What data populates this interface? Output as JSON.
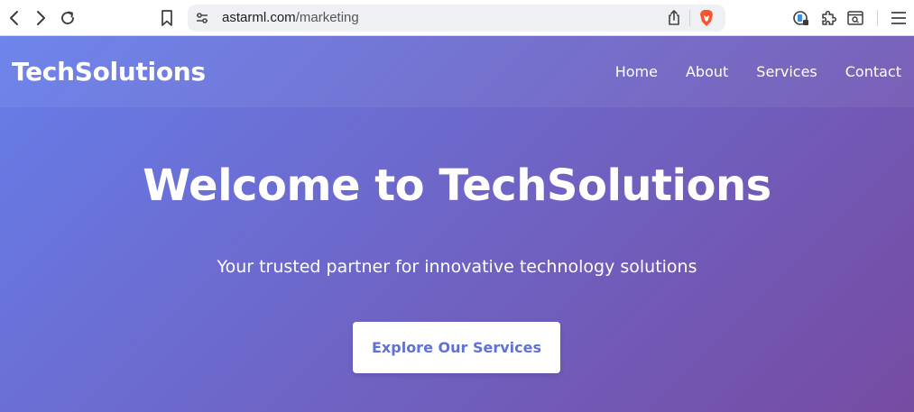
{
  "browser": {
    "url_host": "astarml.com",
    "url_path": "/marketing",
    "brave_color": "#fb542b"
  },
  "site": {
    "brand": "TechSolutions",
    "nav": [
      "Home",
      "About",
      "Services",
      "Contact"
    ],
    "hero_title": "Welcome to TechSolutions",
    "hero_subtitle": "Your trusted partner for innovative technology solutions",
    "cta_label": "Explore Our Services",
    "gradient_start": "#667eea",
    "gradient_end": "#764ba2"
  }
}
